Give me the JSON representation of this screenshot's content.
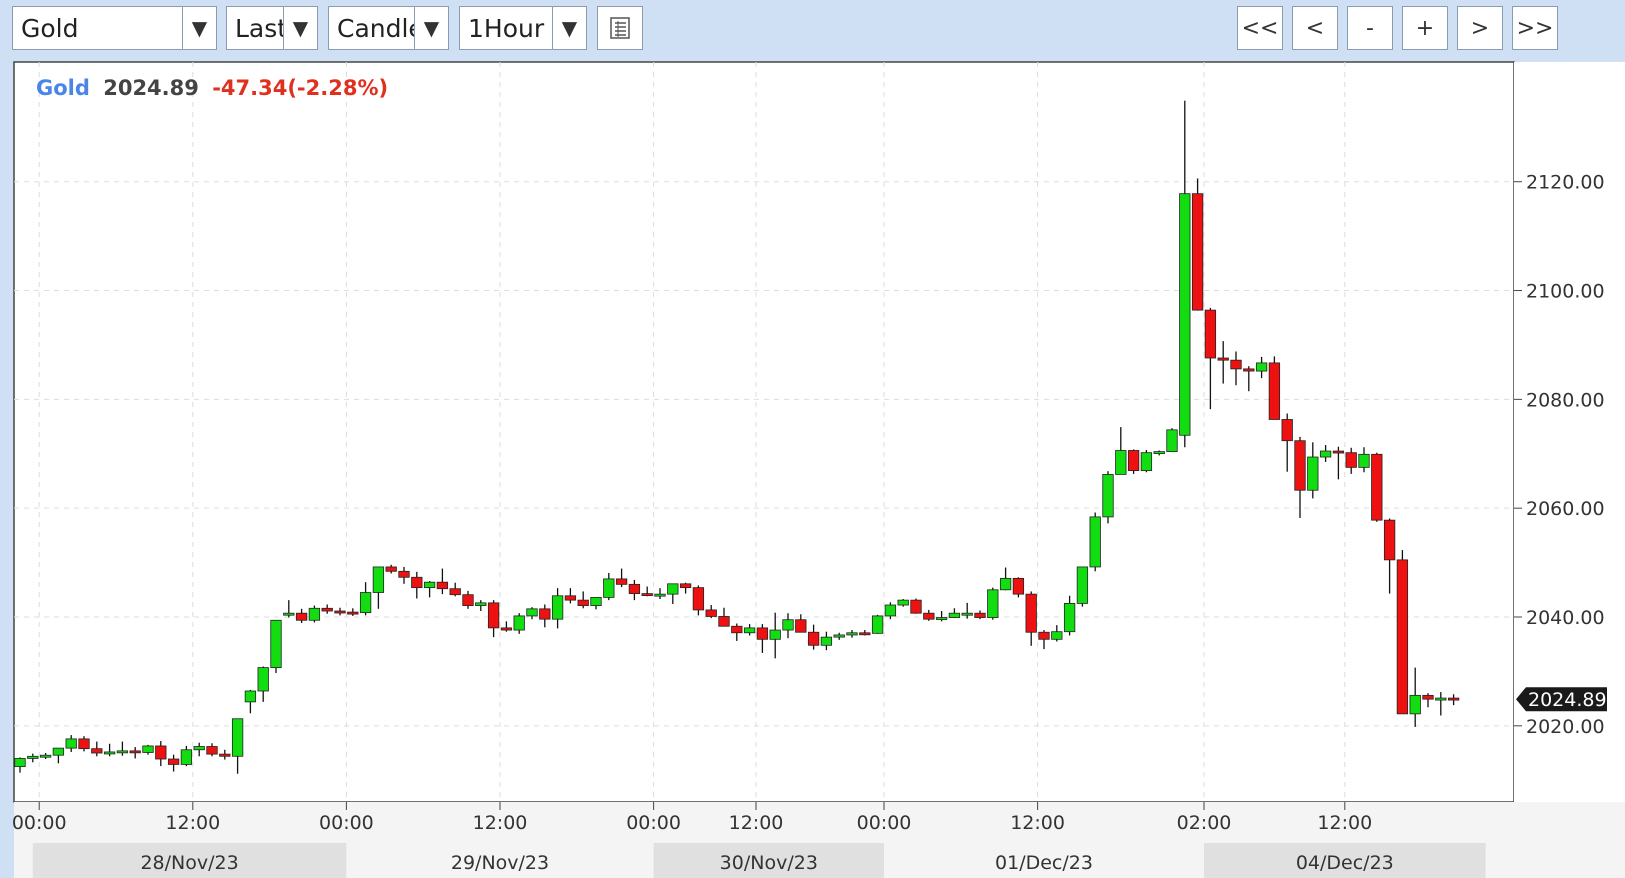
{
  "toolbar": {
    "symbol": "Gold",
    "price_type": "Last",
    "chart_style": "Candle",
    "interval": "1Hour",
    "dropdown_arrow_icon": "triangle-down-icon",
    "table_icon": "table-icon",
    "nav": {
      "first": "<<",
      "prev": "<",
      "zoom_out": "-",
      "zoom_in": "+",
      "next": ">",
      "last": ">>"
    }
  },
  "quote": {
    "name": "Gold",
    "price": "2024.89",
    "change": "-47.34(-2.28%)"
  },
  "colors": {
    "up": "#11dd11",
    "down": "#ee1111",
    "name": "#4a86e8",
    "change": "#e0301e"
  },
  "chart_data": {
    "type": "candlestick",
    "y_ticks": [
      "2120.00",
      "2100.00",
      "2080.00",
      "2060.00",
      "2040.00",
      "2020.00"
    ],
    "y_tick_values": [
      2120,
      2100,
      2080,
      2060,
      2040,
      2020
    ],
    "ylim": [
      2006,
      2142
    ],
    "last_price_label": "2024.89",
    "last_price": 2024.89,
    "x_ticks": [
      "00:00",
      "12:00",
      "00:00",
      "12:00",
      "00:00",
      "12:00",
      "00:00",
      "12:00",
      "02:00",
      "12:00"
    ],
    "x_tick_index": [
      1.5,
      13.5,
      25.5,
      37.5,
      49.5,
      57.5,
      67.5,
      79.5,
      92.5,
      103.5
    ],
    "date_labels": [
      "28/Nov/23",
      "29/Nov/23",
      "30/Nov/23",
      "01/Dec/23",
      "04/Dec/23"
    ],
    "date_bands": [
      [
        1,
        25.5
      ],
      [
        25.5,
        49.5
      ],
      [
        49.5,
        67.5
      ],
      [
        67.5,
        92.5
      ],
      [
        92.5,
        114.5
      ]
    ],
    "grid": true,
    "candles": [
      [
        2012.5,
        2014.2,
        2011.4,
        2014.0
      ],
      [
        2014.0,
        2014.9,
        2013.3,
        2014.4
      ],
      [
        2014.4,
        2015.0,
        2013.9,
        2014.6
      ],
      [
        2014.6,
        2015.1,
        2013.1,
        2015.9
      ],
      [
        2015.9,
        2018.3,
        2015.2,
        2017.6
      ],
      [
        2017.6,
        2018.1,
        2015.3,
        2015.8
      ],
      [
        2015.8,
        2017.1,
        2014.4,
        2015.0
      ],
      [
        2015.0,
        2016.7,
        2014.4,
        2015.2
      ],
      [
        2015.2,
        2017.1,
        2014.5,
        2015.4
      ],
      [
        2015.4,
        2016.1,
        2014.0,
        2015.1
      ],
      [
        2015.1,
        2016.5,
        2014.7,
        2016.3
      ],
      [
        2016.3,
        2017.2,
        2012.6,
        2013.9
      ],
      [
        2013.9,
        2014.7,
        2011.6,
        2012.9
      ],
      [
        2012.9,
        2016.3,
        2012.6,
        2015.6
      ],
      [
        2015.6,
        2016.9,
        2014.4,
        2016.2
      ],
      [
        2016.2,
        2016.8,
        2014.4,
        2014.8
      ],
      [
        2014.8,
        2015.6,
        2013.8,
        2014.4
      ],
      [
        2014.4,
        2021.0,
        2011.2,
        2021.3
      ],
      [
        2024.4,
        2026.6,
        2022.3,
        2026.4
      ],
      [
        2026.4,
        2030.9,
        2024.4,
        2030.7
      ],
      [
        2030.7,
        2039.2,
        2029.7,
        2039.4
      ],
      [
        2040.5,
        2043.1,
        2039.9,
        2040.7
      ],
      [
        2040.7,
        2041.5,
        2038.9,
        2039.4
      ],
      [
        2039.4,
        2042.1,
        2039.0,
        2041.6
      ],
      [
        2041.6,
        2042.3,
        2040.6,
        2041.1
      ],
      [
        2041.1,
        2041.7,
        2040.3,
        2040.9
      ],
      [
        2040.9,
        2041.6,
        2040.2,
        2040.8
      ],
      [
        2040.8,
        2046.4,
        2040.3,
        2044.5
      ],
      [
        2044.5,
        2049.2,
        2041.5,
        2049.2
      ],
      [
        2049.2,
        2049.6,
        2048.0,
        2048.4
      ],
      [
        2048.4,
        2049.2,
        2046.1,
        2047.3
      ],
      [
        2047.3,
        2048.3,
        2043.4,
        2045.4
      ],
      [
        2045.4,
        2046.6,
        2043.6,
        2046.4
      ],
      [
        2046.4,
        2048.9,
        2044.2,
        2045.2
      ],
      [
        2045.2,
        2046.3,
        2043.8,
        2044.1
      ],
      [
        2044.1,
        2044.8,
        2041.5,
        2042.1
      ],
      [
        2042.1,
        2043.1,
        2041.1,
        2042.6
      ],
      [
        2042.6,
        2043.1,
        2036.3,
        2038.0
      ],
      [
        2038.0,
        2039.2,
        2037.3,
        2037.6
      ],
      [
        2037.6,
        2040.7,
        2036.9,
        2040.2
      ],
      [
        2040.2,
        2041.8,
        2039.6,
        2041.5
      ],
      [
        2041.5,
        2042.3,
        2038.1,
        2039.6
      ],
      [
        2039.6,
        2045.3,
        2037.9,
        2043.9
      ],
      [
        2043.9,
        2045.3,
        2042.5,
        2043.1
      ],
      [
        2043.1,
        2044.7,
        2041.6,
        2042.1
      ],
      [
        2042.1,
        2043.6,
        2041.4,
        2043.6
      ],
      [
        2043.6,
        2048.1,
        2043.1,
        2047.0
      ],
      [
        2047.0,
        2048.9,
        2045.5,
        2046.0
      ],
      [
        2046.0,
        2046.8,
        2043.1,
        2044.3
      ],
      [
        2044.3,
        2045.6,
        2043.8,
        2044.1
      ],
      [
        2044.1,
        2045.3,
        2043.3,
        2044.2
      ],
      [
        2044.2,
        2045.3,
        2042.4,
        2046.1
      ],
      [
        2046.1,
        2046.3,
        2044.3,
        2045.4
      ],
      [
        2045.4,
        2045.8,
        2040.3,
        2041.3
      ],
      [
        2041.3,
        2042.2,
        2039.8,
        2040.1
      ],
      [
        2040.1,
        2041.7,
        2038.7,
        2038.3
      ],
      [
        2038.3,
        2038.8,
        2035.6,
        2037.1
      ],
      [
        2037.1,
        2038.7,
        2036.6,
        2038.0
      ],
      [
        2038.0,
        2038.7,
        2033.4,
        2035.9
      ],
      [
        2035.9,
        2040.8,
        2032.4,
        2037.6
      ],
      [
        2037.6,
        2040.7,
        2036.1,
        2039.5
      ],
      [
        2039.5,
        2040.5,
        2037.3,
        2037.2
      ],
      [
        2037.2,
        2038.6,
        2034.0,
        2034.8
      ],
      [
        2034.8,
        2037.3,
        2033.9,
        2036.3
      ],
      [
        2036.3,
        2037.1,
        2035.8,
        2036.7
      ],
      [
        2036.7,
        2037.6,
        2036.2,
        2037.1
      ],
      [
        2037.1,
        2037.6,
        2036.6,
        2037.0
      ],
      [
        2037.0,
        2040.4,
        2036.9,
        2040.2
      ],
      [
        2040.2,
        2042.7,
        2039.6,
        2042.2
      ],
      [
        2042.2,
        2043.3,
        2041.9,
        2043.1
      ],
      [
        2043.1,
        2043.4,
        2040.6,
        2040.7
      ],
      [
        2040.7,
        2041.3,
        2039.3,
        2039.6
      ],
      [
        2039.6,
        2041.1,
        2039.2,
        2039.9
      ],
      [
        2039.9,
        2041.6,
        2039.8,
        2040.7
      ],
      [
        2040.7,
        2042.6,
        2039.7,
        2040.7
      ],
      [
        2040.7,
        2041.2,
        2039.6,
        2039.9
      ],
      [
        2039.9,
        2045.4,
        2039.5,
        2045.0
      ],
      [
        2045.0,
        2049.1,
        2044.9,
        2047.1
      ],
      [
        2047.1,
        2047.3,
        2043.6,
        2044.2
      ],
      [
        2044.2,
        2044.7,
        2034.7,
        2037.2
      ],
      [
        2037.2,
        2037.6,
        2034.1,
        2035.9
      ],
      [
        2035.9,
        2038.5,
        2035.5,
        2037.3
      ],
      [
        2037.3,
        2043.9,
        2036.6,
        2042.5
      ],
      [
        2042.5,
        2049.1,
        2041.9,
        2049.2
      ],
      [
        2049.2,
        2059.2,
        2048.4,
        2058.4
      ],
      [
        2058.4,
        2066.8,
        2057.2,
        2066.2
      ],
      [
        2066.2,
        2074.9,
        2066.6,
        2070.6
      ],
      [
        2070.6,
        2070.8,
        2066.3,
        2066.9
      ],
      [
        2066.9,
        2070.7,
        2066.6,
        2070.2
      ],
      [
        2070.2,
        2070.6,
        2069.7,
        2070.4
      ],
      [
        2070.4,
        2074.7,
        2071.2,
        2074.4
      ],
      [
        2073.4,
        2134.9,
        2071.2,
        2117.8
      ],
      [
        2117.8,
        2120.6,
        2096.3,
        2096.4
      ],
      [
        2096.4,
        2096.8,
        2078.2,
        2087.6
      ],
      [
        2087.6,
        2090.7,
        2082.9,
        2087.2
      ],
      [
        2087.2,
        2088.8,
        2082.6,
        2085.6
      ],
      [
        2085.6,
        2086.1,
        2081.5,
        2085.2
      ],
      [
        2085.2,
        2087.8,
        2083.9,
        2086.7
      ],
      [
        2086.7,
        2087.9,
        2083.6,
        2076.3
      ],
      [
        2076.3,
        2077.4,
        2066.7,
        2072.4
      ],
      [
        2072.4,
        2073.1,
        2058.2,
        2063.3
      ],
      [
        2063.3,
        2072.1,
        2061.8,
        2069.4
      ],
      [
        2069.4,
        2071.6,
        2068.5,
        2070.5
      ],
      [
        2070.5,
        2071.3,
        2065.3,
        2070.2
      ],
      [
        2070.2,
        2071.1,
        2066.3,
        2067.5
      ],
      [
        2067.5,
        2071.2,
        2066.6,
        2069.9
      ],
      [
        2069.9,
        2070.2,
        2057.5,
        2057.8
      ],
      [
        2057.8,
        2058.1,
        2044.3,
        2050.5
      ],
      [
        2050.5,
        2052.3,
        2035.6,
        2022.2
      ],
      [
        2022.2,
        2030.7,
        2019.8,
        2025.6
      ],
      [
        2025.6,
        2026.0,
        2023.4,
        2024.9
      ],
      [
        2024.9,
        2026.2,
        2021.9,
        2025.1
      ],
      [
        2025.1,
        2025.8,
        2023.8,
        2024.9
      ]
    ]
  }
}
